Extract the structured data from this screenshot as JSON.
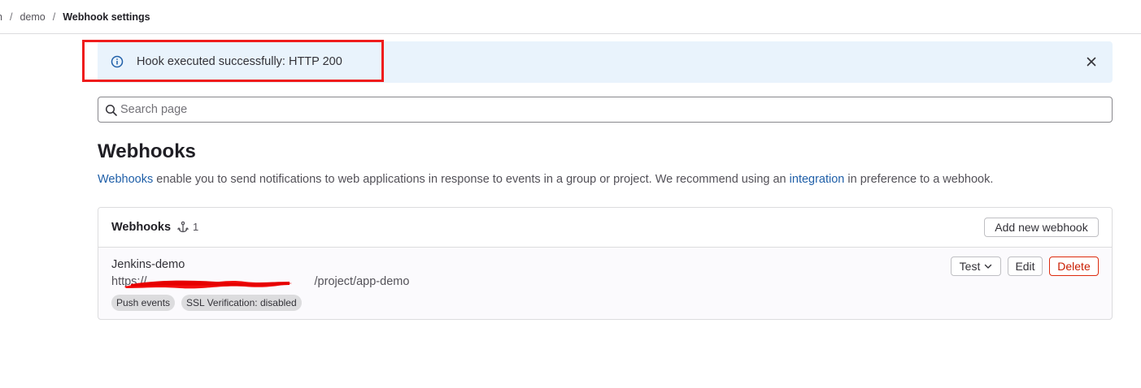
{
  "breadcrumb": {
    "items": [
      "n",
      "demo"
    ],
    "current": "Webhook settings",
    "separator": "/"
  },
  "alert": {
    "icon": "info-icon",
    "message": "Hook executed successfully: HTTP 200",
    "close_icon": "close-icon"
  },
  "search": {
    "placeholder": "Search page",
    "value": ""
  },
  "page": {
    "title": "Webhooks",
    "description": {
      "link1": "Webhooks",
      "text1": " enable you to send notifications to web applications in response to events in a group or project. We recommend using an ",
      "link2": "integration",
      "text2": " in preference to a webhook."
    }
  },
  "webhooks_card": {
    "title": "Webhooks",
    "icon": "webhook-icon",
    "count": "1",
    "add_button": "Add new webhook",
    "items": [
      {
        "name": "Jenkins-demo",
        "url_prefix": "https://",
        "url_suffix": "/project/app-demo",
        "badges": [
          "Push events",
          "SSL Verification: disabled"
        ],
        "actions": {
          "test": "Test",
          "edit": "Edit",
          "delete": "Delete"
        }
      }
    ]
  },
  "colors": {
    "alert_bg": "#e9f3fc",
    "link": "#1f5fa8",
    "danger": "#dd2b0e",
    "annotation": "#ef1c1c"
  }
}
